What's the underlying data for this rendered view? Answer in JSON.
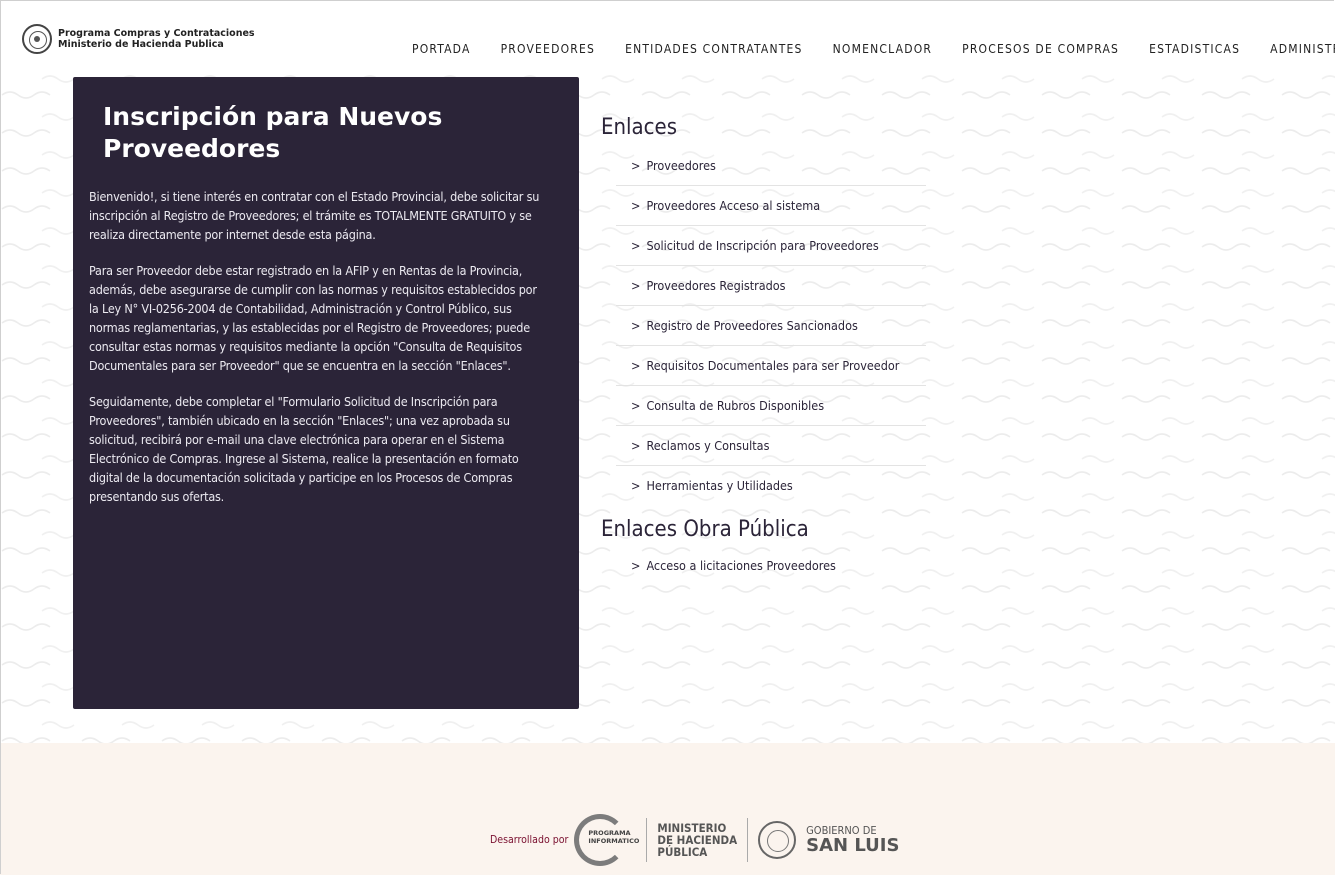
{
  "header": {
    "logo_line1": "Programa Compras y Contrataciones",
    "logo_line2": "Ministerio de Hacienda Publica",
    "nav": [
      {
        "label": "PORTADA"
      },
      {
        "label": "PROVEEDORES"
      },
      {
        "label": "ENTIDADES CONTRATANTES"
      },
      {
        "label": "NOMENCLADOR"
      },
      {
        "label": "PROCESOS DE COMPRAS"
      },
      {
        "label": "ESTADISTICAS"
      },
      {
        "label": "ADMINISTRACION"
      }
    ]
  },
  "panel": {
    "title": "Inscripción para Nuevos Proveedores",
    "paragraphs": [
      "Bienvenido!, si tiene interés en contratar con el Estado Provincial, debe solicitar su inscripción al Registro de Proveedores; el trámite es TOTALMENTE GRATUITO y se realiza directamente por internet desde esta página.",
      "Para ser Proveedor debe estar registrado en la AFIP y en Rentas de la Provincia, además, debe asegurarse de cumplir con las normas y requisitos establecidos por la Ley N° VI-0256-2004 de Contabilidad, Administración y Control Público, sus normas reglamentarias, y las establecidas por el Registro de Proveedores; puede consultar estas normas y requisitos mediante la opción \"Consulta de Requisitos Documentales para ser Proveedor\" que se encuentra en la sección \"Enlaces\".",
      "Seguidamente, debe completar el \"Formulario Solicitud de Inscripción para Proveedores\", también ubicado en la sección \"Enlaces\"; una vez aprobada su solicitud, recibirá por e-mail una clave electrónica para operar en el Sistema Electrónico de Compras. Ingrese al Sistema, realice la presentación en formato digital de la documentación solicitada y participe en los Procesos de Compras presentando sus ofertas."
    ]
  },
  "links": {
    "heading": "Enlaces",
    "items": [
      {
        "label": "Proveedores"
      },
      {
        "label": "Proveedores Acceso al sistema"
      },
      {
        "label": "Solicitud de Inscripción para Proveedores"
      },
      {
        "label": "Proveedores Registrados"
      },
      {
        "label": "Registro de Proveedores Sancionados"
      },
      {
        "label": "Requisitos Documentales para ser Proveedor"
      },
      {
        "label": "Consulta de Rubros Disponibles"
      },
      {
        "label": "Reclamos y Consultas"
      },
      {
        "label": "Herramientas y Utilidades"
      }
    ],
    "arrow": ">"
  },
  "links_obra": {
    "heading": "Enlaces Obra Pública",
    "items": [
      {
        "label": "Acceso a licitaciones Proveedores"
      }
    ]
  },
  "footer": {
    "developed_by": "Desarrollado por",
    "pi_logo": [
      "PROGRAMA",
      "INFORMATICO"
    ],
    "ministerio": [
      "MINISTERIO",
      "DE HACIENDA",
      "PÚBLICA"
    ],
    "gobierno_small": "GOBIERNO DE",
    "gobierno_big": "SAN LUIS"
  },
  "colors": {
    "panel_bg": "#2b2438",
    "footer_bg": "#fbf4ee",
    "accent_text": "#7a1030"
  }
}
